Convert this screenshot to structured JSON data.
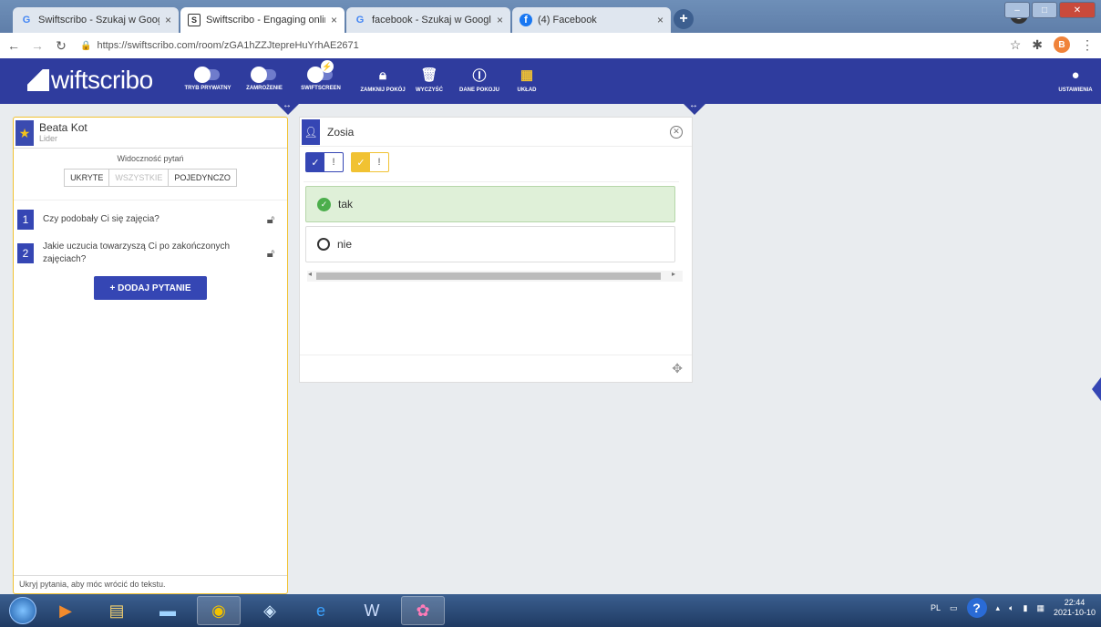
{
  "browser": {
    "tabs": [
      {
        "icon": "G",
        "title": "Swiftscribo - Szukaj w Google"
      },
      {
        "icon": "S",
        "title": "Swiftscribo - Engaging online cla"
      },
      {
        "icon": "G",
        "title": "facebook - Szukaj w Google"
      },
      {
        "icon": "f",
        "title": "(4) Facebook"
      }
    ],
    "url": "https://swiftscribo.com/room/zGA1hZZJtepreHuYrhAE2671",
    "profile_initial": "B"
  },
  "app": {
    "logo": "wiftscribo",
    "toolbar": [
      {
        "label": "TRYB PRYWATNY"
      },
      {
        "label": "ZAMROŻENIE"
      },
      {
        "label": "SWIFTSCREEN"
      },
      {
        "label": "ZAMKNIJ POKÓJ"
      },
      {
        "label": "WYCZYŚĆ"
      },
      {
        "label": "DANE POKOJU"
      },
      {
        "label": "UKŁAD"
      }
    ],
    "settings_label": "USTAWIENIA"
  },
  "left_panel": {
    "user_name": "Beata Kot",
    "user_role": "Lider",
    "visibility_label": "Widoczność pytań",
    "visibility_options": [
      "UKRYTE",
      "WSZYSTKIE",
      "POJEDYNCZO"
    ],
    "questions": [
      {
        "num": "1",
        "text": "Czy podobały Ci się zajęcia?"
      },
      {
        "num": "2",
        "text": "Jakie uczucia towarzyszą Ci po zakończonych zajęciach?"
      }
    ],
    "add_button": "+ DODAJ PYTANIE",
    "footer_hint": "Ukryj pytania, aby móc wrócić do tekstu."
  },
  "card": {
    "student_name": "Zosia",
    "options": [
      {
        "text": "tak",
        "selected": true
      },
      {
        "text": "nie",
        "selected": false
      }
    ]
  },
  "taskbar": {
    "lang": "PL",
    "time": "22:44",
    "date": "2021-10-10"
  }
}
